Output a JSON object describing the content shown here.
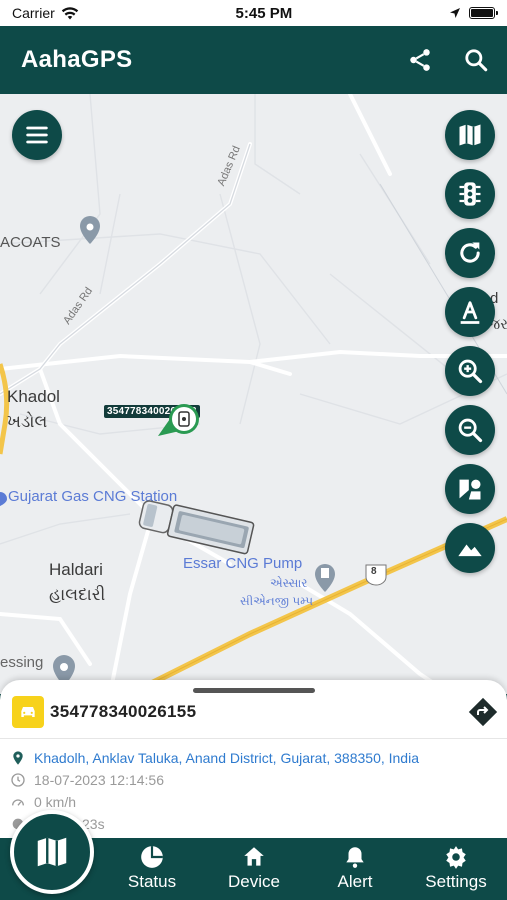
{
  "status_bar": {
    "carrier": "Carrier",
    "time": "5:45 PM"
  },
  "app_bar": {
    "title": "AahaGPS",
    "share_icon": "share-icon",
    "search_icon": "search-icon"
  },
  "map": {
    "labels": {
      "adas_rd_1": "Adas Rd",
      "adas_rd_2": "Adas Rd",
      "acoats": "ACOATS",
      "khadol": "Khadol",
      "khadol_gujarati": "ખડોલ",
      "gujarat_gas": "Gujarat Gas CNG Station",
      "essar": "Essar CNG Pump",
      "essar_gu1": "એસ્સાર",
      "essar_gu2": "સીએનજી પમ્પ",
      "haldari": "Haldari",
      "haldari_gujarati": "હાલદારી",
      "essing": "essing",
      "highway_shield": "8",
      "right_gu": "જરા",
      "right_d": "d"
    },
    "vehicle_tag": "3547783400261...2",
    "fab_buttons": [
      "map-layers-icon",
      "traffic-icon",
      "refresh-icon",
      "text-label-icon",
      "zoom-in-icon",
      "zoom-out-icon",
      "satellite-icon",
      "terrain-icon"
    ]
  },
  "details": {
    "imei": "354778340026155",
    "address": "Khadolh, Anklav Taluka, Anand District, Gujarat, 388350, India",
    "datetime": "18-07-2023 12:14:56",
    "speed": "0 km/h",
    "duration": "23s"
  },
  "nav": {
    "items": [
      {
        "label": "Status",
        "icon": "pie-chart-icon"
      },
      {
        "label": "Device",
        "icon": "home-icon"
      },
      {
        "label": "Alert",
        "icon": "bell-icon"
      },
      {
        "label": "Settings",
        "icon": "gear-icon"
      }
    ],
    "center_icon": "map-icon"
  },
  "colors": {
    "primary": "#0e4a48",
    "accent": "#f7d21b",
    "link": "#2f7bcf"
  }
}
